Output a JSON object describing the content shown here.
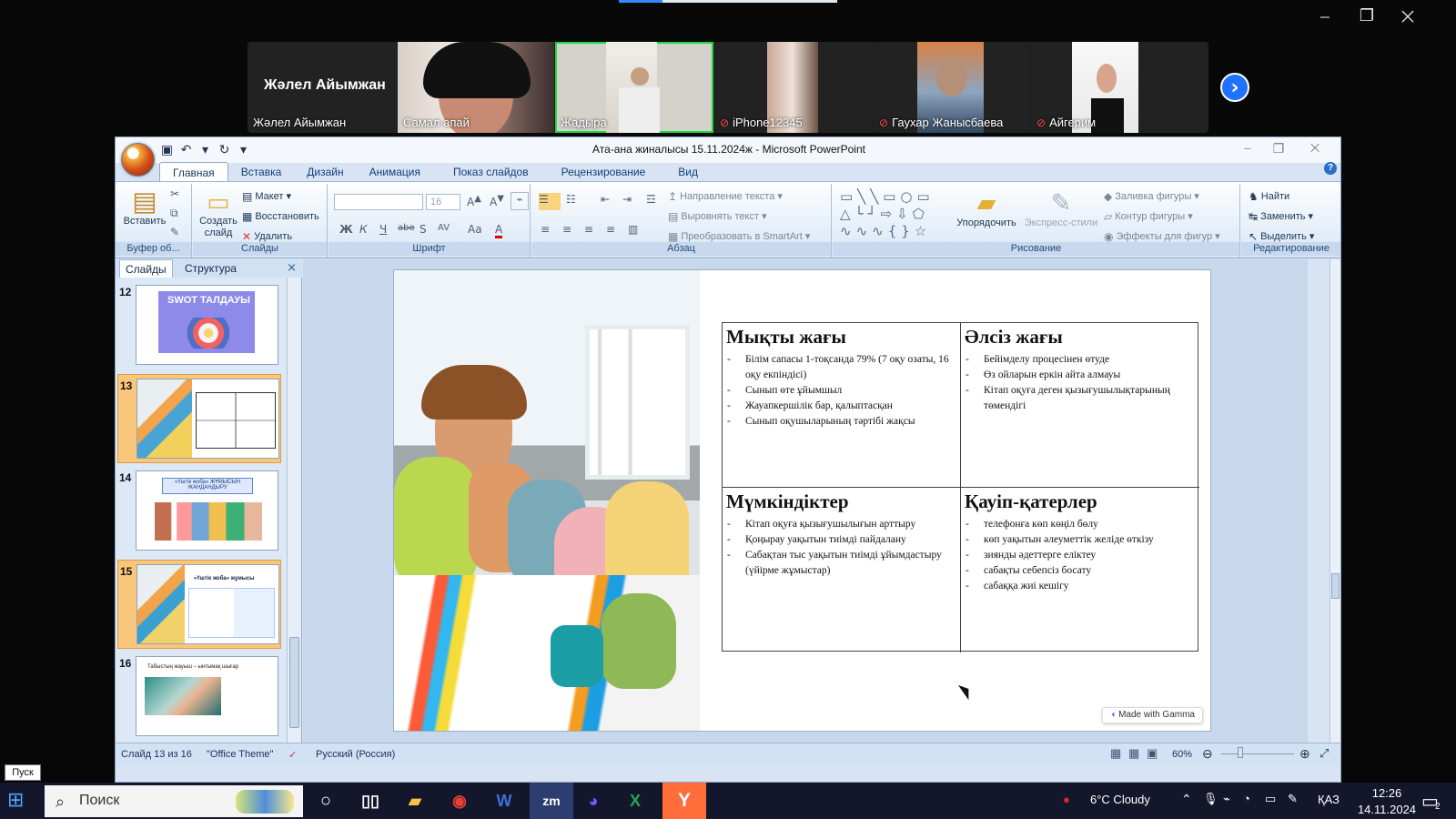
{
  "zoom": {
    "participants": [
      {
        "label": "Жәлел Айымжан",
        "big_label": "Жәлел Айымжан",
        "muted": false
      },
      {
        "label": "Самал апай",
        "muted": false
      },
      {
        "label": "Жадыра",
        "muted": false,
        "active": true
      },
      {
        "label": "iPhone12345",
        "muted": true
      },
      {
        "label": "Гаухар Жанысбаева",
        "muted": true
      },
      {
        "label": "Айгерим",
        "muted": true
      }
    ],
    "colors": {
      "active_border": "#1fda3e",
      "next_button": "#2073ff"
    },
    "icons": {
      "next": "chevron-right-icon",
      "muted": "microphone-muted-icon"
    }
  },
  "window": {
    "title": "Ата-ана жиналысы 15.11.2024ж - Microsoft PowerPoint"
  },
  "ribbon": {
    "tabs": [
      "Главная",
      "Вставка",
      "Дизайн",
      "Анимация",
      "Показ слайдов",
      "Рецензирование",
      "Вид"
    ],
    "clipboard": {
      "paste": "Вставить",
      "label": "Буфер об..."
    },
    "slides": {
      "create": "Создать слайд",
      "layout": "Макет",
      "restore": "Восстановить",
      "delete": "Удалить",
      "label": "Слайды"
    },
    "font": {
      "font_size": "16",
      "label": "Шрифт",
      "bold": "Ж",
      "italic": "К",
      "underline": "Ч",
      "strike": "abe",
      "shadow": "S",
      "spacing": "AV",
      "case": "Aa"
    },
    "paragraph": {
      "direction": "Направление текста",
      "align": "Выровнять текст",
      "smartart": "Преобразовать в SmartArt",
      "label": "Абзац"
    },
    "drawing": {
      "arrange": "Упорядочить",
      "styles": "Экспресс-стили",
      "fill": "Заливка фигуры",
      "outline": "Контур фигуры",
      "effects": "Эффекты для фигур",
      "label": "Рисование"
    },
    "editing": {
      "find": "Найти",
      "replace": "Заменить",
      "select": "Выделить",
      "label": "Редактирование"
    }
  },
  "panel": {
    "tabs": [
      "Слайды",
      "Структура"
    ],
    "thumbs": [
      {
        "num": "12",
        "title": "SWOT ТАЛДАУЫ",
        "selected": false
      },
      {
        "num": "13",
        "selected": true
      },
      {
        "num": "14",
        "title": "«Үштік жоба» ЖҰМЫСЫН ЖАНДАНДЫРУ",
        "selected": false
      },
      {
        "num": "15",
        "title": "«Үштік жоба» жұмысы",
        "selected": true
      },
      {
        "num": "16",
        "title": "Табыстың жауыш  –  ынтымақ шығар",
        "selected": false
      }
    ]
  },
  "slide": {
    "gamma": "Made with Gamma",
    "quadrants": [
      {
        "title": "Мықты жағы",
        "items": [
          "Білім сапасы 1-тоқсанда 79% (7 оқу озаты, 16 оқу екпіндісі)",
          "Сынып өте ұйымшыл",
          "Жауапкершілік бар, қалыптасқан",
          "Сынып оқушыларының тәртібі жақсы"
        ]
      },
      {
        "title": "Әлсіз жағы",
        "items": [
          "Бейімделу процесінен өтуде",
          "Өз ойларын еркін айта алмауы",
          "Кітап оқуға деген қызығушылықтарының төмендігі"
        ]
      },
      {
        "title": "Мүмкіндіктер",
        "items": [
          "Кітап оқуға қызығушылығын арттыру",
          "Қоңырау уақытын тиімді пайдалану",
          "Сабақтан тыс уақытын тиімді ұйымдастыру (үйірме жұмыстар)"
        ]
      },
      {
        "title": "Қауіп-қатерлер",
        "items": [
          "телефонға көп көңіл бөлу",
          "көп уақытын әлеуметтік желіде өткізу",
          "зиянды әдеттерге еліктеу",
          "сабақты себепсіз босату",
          "сабаққа жиі кешігу"
        ]
      }
    ]
  },
  "status": {
    "slide": "Слайд 13 из 16",
    "theme": "\"Office Theme\"",
    "language": "Русский (Россия)",
    "zoom": "60%"
  },
  "taskbar": {
    "search": "Поиск",
    "start_tip": "Пуск",
    "weather": "6°C  Cloudy",
    "lang": "ҚАЗ",
    "time": "12:26",
    "date": "14.11.2024",
    "notification_count": "2"
  }
}
